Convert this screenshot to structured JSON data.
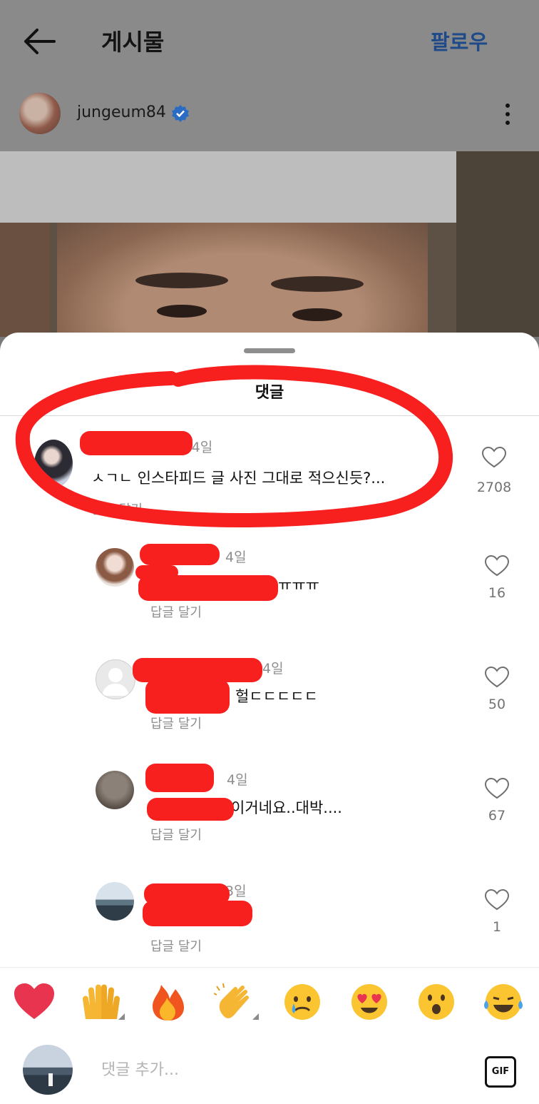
{
  "header": {
    "back_icon": "arrow-left-icon",
    "title": "게시물",
    "follow_label": "팔로우",
    "follow_color": "#1f4a8a"
  },
  "post": {
    "author": "jungeum84",
    "verified_icon": "verified-badge-icon",
    "more_icon": "more-vertical-icon"
  },
  "comments_sheet": {
    "title": "댓글",
    "comments": [
      {
        "time": "4일",
        "text": "ㅅㄱㄴ 인스타피드 글 사진 그대로 적으신듯?...",
        "reply_label": "답글 달기",
        "likes": "2708"
      },
      {
        "time": "4일",
        "text": "ㅠㅠㅠ",
        "reply_label": "답글 달기",
        "likes": "16"
      },
      {
        "time": "4일",
        "text": "헐ㄷㄷㄷㄷㄷ",
        "reply_label": "답글 달기",
        "likes": "50"
      },
      {
        "time": "4일",
        "text": "이거네요..대박....",
        "reply_label": "답글 달기",
        "likes": "67"
      },
      {
        "time": "3일",
        "text": "",
        "reply_label": "답글 달기",
        "likes": "1"
      }
    ]
  },
  "reactions": [
    "❤️",
    "🙌",
    "🔥",
    "👏",
    "😢",
    "😍",
    "😮",
    "😂"
  ],
  "composer": {
    "placeholder": "댓글 추가...",
    "gif_label": "GIF"
  },
  "colors": {
    "redaction": "#f81f1f",
    "circle_annotation": "#f81f1f"
  }
}
